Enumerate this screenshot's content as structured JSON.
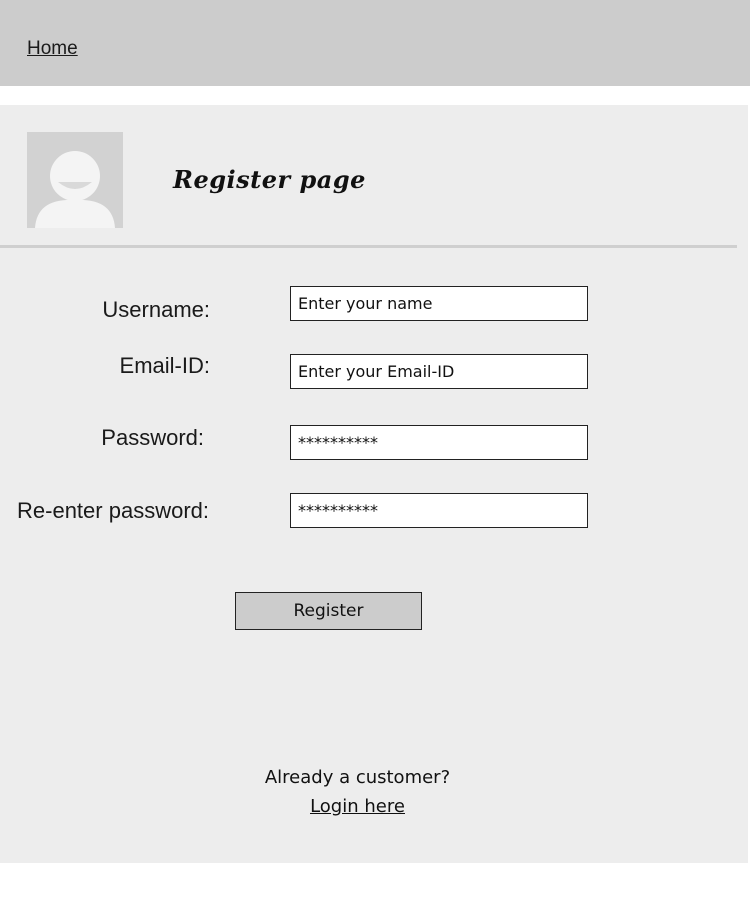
{
  "nav": {
    "home_label": "Home"
  },
  "header": {
    "title": "Register page",
    "avatar_icon": "user-avatar-icon"
  },
  "form": {
    "username": {
      "label": "Username:",
      "placeholder": "Enter your name",
      "value": ""
    },
    "email": {
      "label": "Email-ID:",
      "placeholder": "Enter your Email-ID",
      "value": ""
    },
    "password": {
      "label": "Password:",
      "value": "**********"
    },
    "confirm_password": {
      "label": "Re-enter password:",
      "value": "**********"
    },
    "submit_label": "Register"
  },
  "footer": {
    "prompt": "Already a customer?",
    "login_label": "Login here"
  },
  "colors": {
    "topbar": "#cccccc",
    "panel": "#ededed",
    "button": "#cccccc"
  }
}
